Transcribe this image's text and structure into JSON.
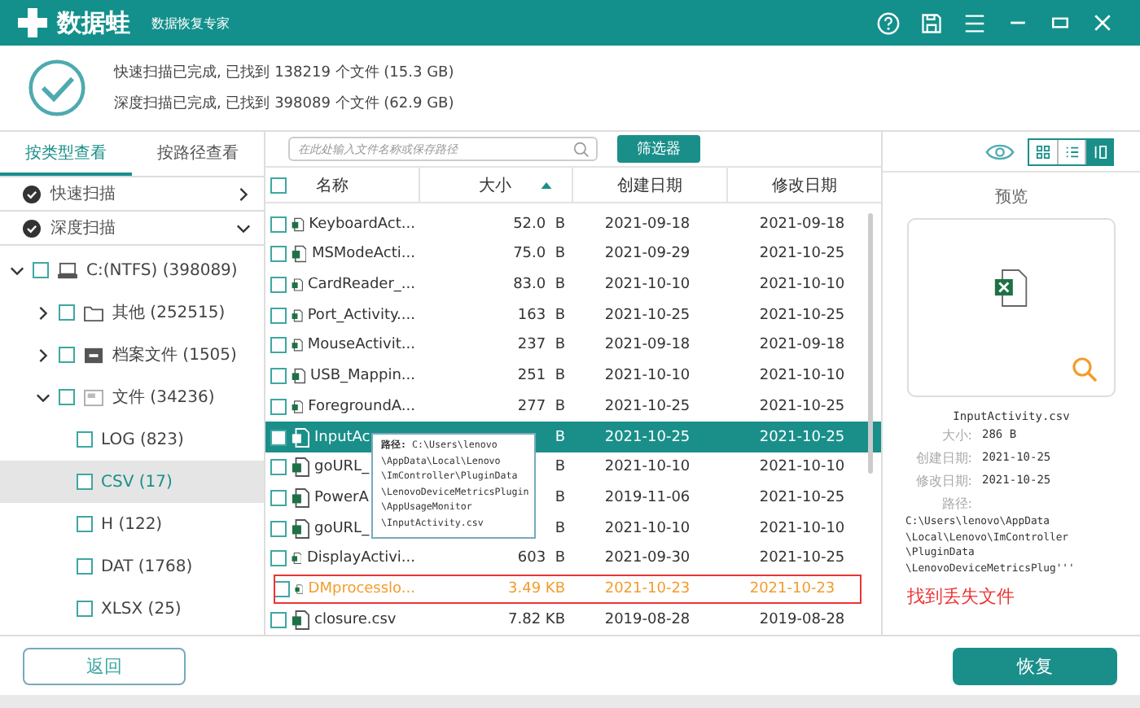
{
  "app": {
    "name": "数据蛙",
    "tagline": "数据恢复专家"
  },
  "summary": [
    "快速扫描已完成, 已找到 138219 个文件 (15.3 GB)",
    "深度扫描已完成, 已找到 398089 个文件 (62.9 GB)"
  ],
  "view_tabs": [
    {
      "label": "按类型查看",
      "selected": true
    },
    {
      "label": "按路径查看",
      "selected": false
    }
  ],
  "scans": [
    {
      "label": "快速扫描",
      "expanded": false
    },
    {
      "label": "深度扫描",
      "expanded": true,
      "children": [
        {
          "label": "C:(NTFS) (398089)",
          "kind": "drive",
          "expanded": true,
          "selected": false,
          "children": [
            {
              "label": "其他 (252515)",
              "kind": "folder",
              "expanded": false,
              "selected": false
            },
            {
              "label": "档案文件 (1505)",
              "kind": "archive",
              "expanded": false,
              "selected": false
            },
            {
              "label": "文件 (34236)",
              "kind": "document",
              "expanded": true,
              "selected": false,
              "children": [
                {
                  "label": "LOG (823)",
                  "kind": "type",
                  "selected": false
                },
                {
                  "label": "CSV (17)",
                  "kind": "type",
                  "selected": true
                },
                {
                  "label": "H (122)",
                  "kind": "type",
                  "selected": false
                },
                {
                  "label": "DAT (1768)",
                  "kind": "type",
                  "selected": false
                },
                {
                  "label": "XLSX (25)",
                  "kind": "type",
                  "selected": false
                }
              ]
            }
          ]
        }
      ]
    }
  ],
  "search": {
    "placeholder": "在此处输入文件名称或保存路径"
  },
  "filter_button": "筛选器",
  "layouts": [
    {
      "kind": "grid",
      "selected": false
    },
    {
      "kind": "list",
      "selected": false
    },
    {
      "kind": "preview",
      "selected": true
    }
  ],
  "table": {
    "select_all": {
      "checked": false
    },
    "columns": [
      "名称",
      "大小",
      "创建日期",
      "修改日期"
    ],
    "rows": [
      {
        "name": "KeyboardAct...",
        "size": "52.0  B",
        "created": "2021-09-18",
        "modified": "2021-09-18",
        "selected": false,
        "highlighted": false
      },
      {
        "name": "MSModeActi...",
        "size": "75.0  B",
        "created": "2021-09-29",
        "modified": "2021-10-25",
        "selected": false,
        "highlighted": false
      },
      {
        "name": "CardReader_...",
        "size": "83.0  B",
        "created": "2021-10-10",
        "modified": "2021-10-10",
        "selected": false,
        "highlighted": false
      },
      {
        "name": "Port_Activity....",
        "size": "163  B",
        "created": "2021-10-25",
        "modified": "2021-10-25",
        "selected": false,
        "highlighted": false
      },
      {
        "name": "MouseActivit...",
        "size": "237  B",
        "created": "2021-09-18",
        "modified": "2021-09-18",
        "selected": false,
        "highlighted": false
      },
      {
        "name": "USB_Mappin...",
        "size": "251  B",
        "created": "2021-10-10",
        "modified": "2021-10-10",
        "selected": false,
        "highlighted": false
      },
      {
        "name": "ForegroundA...",
        "size": "277  B",
        "created": "2021-10-25",
        "modified": "2021-10-25",
        "selected": false,
        "highlighted": false
      },
      {
        "name": "InputAc",
        "size": "B",
        "created": "2021-10-25",
        "modified": "2021-10-25",
        "selected": true,
        "highlighted": false
      },
      {
        "name": "goURL_",
        "size": "B",
        "created": "2021-10-10",
        "modified": "2021-10-10",
        "selected": false,
        "highlighted": false
      },
      {
        "name": "PowerA",
        "size": "B",
        "created": "2019-11-06",
        "modified": "2021-10-25",
        "selected": false,
        "highlighted": false
      },
      {
        "name": "goURL_",
        "size": "B",
        "created": "2021-10-10",
        "modified": "2021-10-10",
        "selected": false,
        "highlighted": false
      },
      {
        "name": "DisplayActivi...",
        "size": "603  B",
        "created": "2021-09-30",
        "modified": "2021-10-25",
        "selected": false,
        "highlighted": false
      },
      {
        "name": "DMprocesslo...",
        "size": "3.49 KB",
        "created": "2021-10-23",
        "modified": "2021-10-23",
        "selected": false,
        "highlighted": true
      },
      {
        "name": "closure.csv",
        "size": "7.82 KB",
        "created": "2019-08-28",
        "modified": "2019-08-28",
        "selected": false,
        "highlighted": false
      }
    ]
  },
  "tooltip": {
    "label": "路径:",
    "lines": [
      "C:\\Users\\lenovo",
      "\\AppData\\Local\\Lenovo",
      "\\ImController\\PluginData",
      "\\LenovoDeviceMetricsPlugin",
      "\\AppUsageMonitor",
      "\\InputActivity.csv"
    ]
  },
  "preview": {
    "title": "预览",
    "file_name": "InputActivity.csv",
    "fields": [
      {
        "label": "大小:",
        "value": "286  B"
      },
      {
        "label": "创建日期:",
        "value": "2021-10-25"
      },
      {
        "label": "修改日期:",
        "value": "2021-10-25"
      }
    ],
    "path_label": "路径:",
    "path_lines": [
      "C:\\Users\\lenovo\\AppData",
      "\\Local\\Lenovo\\ImController",
      "\\PluginData",
      "\\LenovoDeviceMetricsPlug'''"
    ],
    "note": "找到丢失文件"
  },
  "buttons": {
    "back": "返回",
    "recover": "恢复"
  }
}
